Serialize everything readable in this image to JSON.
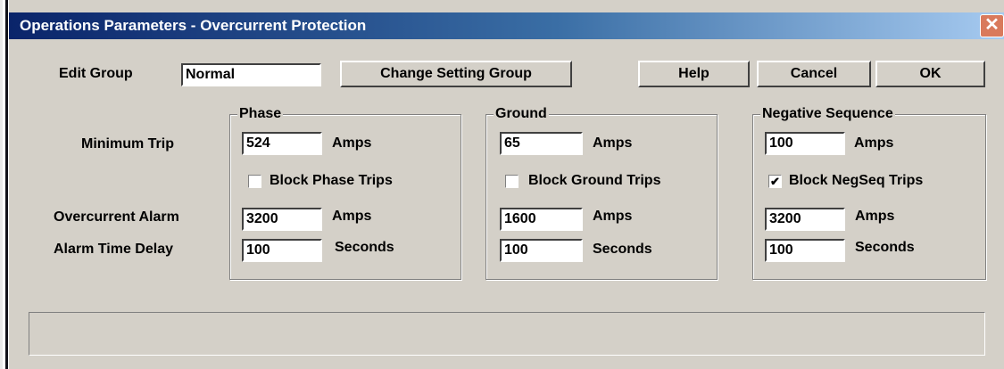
{
  "window": {
    "title": "Operations Parameters - Overcurrent Protection",
    "close_glyph": "✕"
  },
  "header": {
    "edit_group_label": "Edit Group",
    "edit_group_value": "Normal",
    "change_setting_group": "Change Setting Group",
    "help": "Help",
    "cancel": "Cancel",
    "ok": "OK"
  },
  "rows": {
    "minimum_trip": "Minimum Trip",
    "overcurrent_alarm": "Overcurrent Alarm",
    "alarm_time_delay": "Alarm Time Delay"
  },
  "phase": {
    "title": "Phase",
    "minimum_trip": "524",
    "minimum_trip_unit": "Amps",
    "block_label": "Block Phase Trips",
    "block_checked": false,
    "overcurrent_alarm": "3200",
    "overcurrent_alarm_unit": "Amps",
    "alarm_delay": "100",
    "alarm_delay_unit": "Seconds"
  },
  "ground": {
    "title": "Ground",
    "minimum_trip": "65",
    "minimum_trip_unit": "Amps",
    "block_label": "Block Ground Trips",
    "block_checked": false,
    "overcurrent_alarm": "1600",
    "overcurrent_alarm_unit": "Amps",
    "alarm_delay": "100",
    "alarm_delay_unit": "Seconds"
  },
  "negseq": {
    "title": "Negative Sequence",
    "minimum_trip": "100",
    "minimum_trip_unit": "Amps",
    "block_label": "Block NegSeq Trips",
    "block_checked": true,
    "check_glyph": "✔",
    "overcurrent_alarm": "3200",
    "overcurrent_alarm_unit": "Amps",
    "alarm_delay": "100",
    "alarm_delay_unit": "Seconds"
  },
  "status": {
    "text": ""
  },
  "colors": {
    "title_start": "#0a246a",
    "title_end": "#a6caf0",
    "face": "#d4d0c8",
    "close": "#d97a5c"
  }
}
